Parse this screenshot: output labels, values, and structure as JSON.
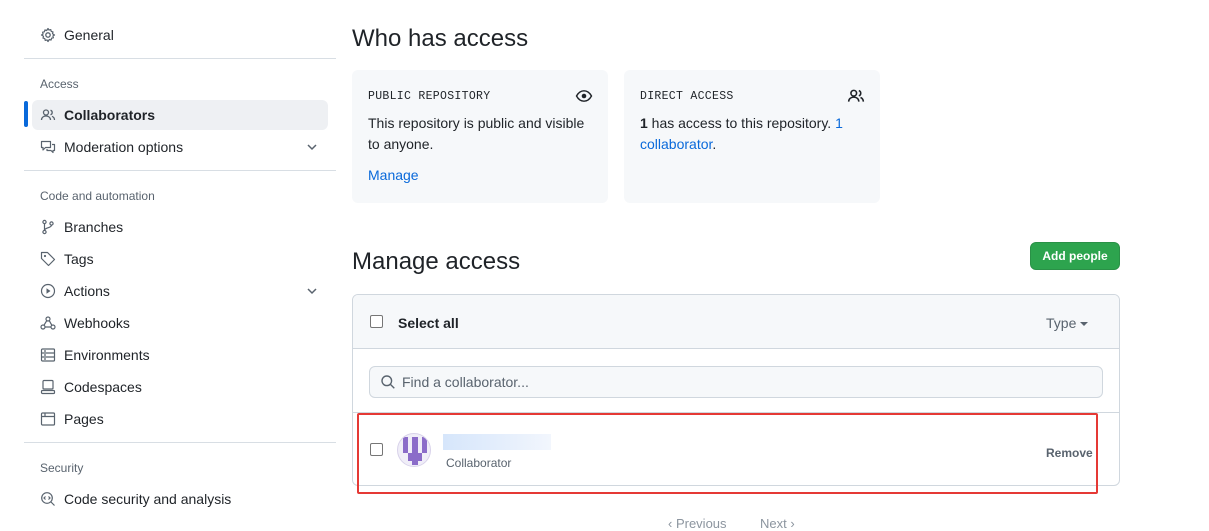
{
  "sidebar": {
    "general": {
      "label": "General",
      "icon": "gear-icon"
    },
    "access_group": {
      "title": "Access",
      "items": [
        {
          "label": "Collaborators",
          "icon": "people-icon",
          "active": true
        },
        {
          "label": "Moderation options",
          "icon": "report-icon",
          "expandable": true
        }
      ]
    },
    "code_group": {
      "title": "Code and automation",
      "items": [
        {
          "label": "Branches",
          "icon": "git-branch-icon"
        },
        {
          "label": "Tags",
          "icon": "tag-icon"
        },
        {
          "label": "Actions",
          "icon": "play-icon",
          "expandable": true
        },
        {
          "label": "Webhooks",
          "icon": "webhook-icon"
        },
        {
          "label": "Environments",
          "icon": "server-icon"
        },
        {
          "label": "Codespaces",
          "icon": "codespaces-icon"
        },
        {
          "label": "Pages",
          "icon": "browser-icon"
        }
      ]
    },
    "security_group": {
      "title": "Security",
      "items": [
        {
          "label": "Code security and analysis",
          "icon": "codescan-icon"
        }
      ]
    }
  },
  "who_has_access": {
    "heading": "Who has access",
    "public_card": {
      "label": "PUBLIC REPOSITORY",
      "text": "This repository is public and visible to anyone.",
      "link": "Manage",
      "icon": "eye-icon"
    },
    "direct_card": {
      "label": "DIRECT ACCESS",
      "count_bold": "1",
      "text": " has access to this repository. ",
      "link": "1 collaborator",
      "suffix": ".",
      "icon": "people-icon"
    }
  },
  "manage_access": {
    "heading": "Manage access",
    "add_button": "Add people",
    "select_all": "Select all",
    "type_filter": "Type",
    "search_placeholder": "Find a collaborator...",
    "members": [
      {
        "name": "",
        "role": "Collaborator",
        "remove": "Remove"
      }
    ]
  },
  "pagination": {
    "previous": "Previous",
    "next": "Next"
  },
  "colors": {
    "accent": "#0969da",
    "primary_button": "#2da44e",
    "highlight": "#e53935"
  }
}
